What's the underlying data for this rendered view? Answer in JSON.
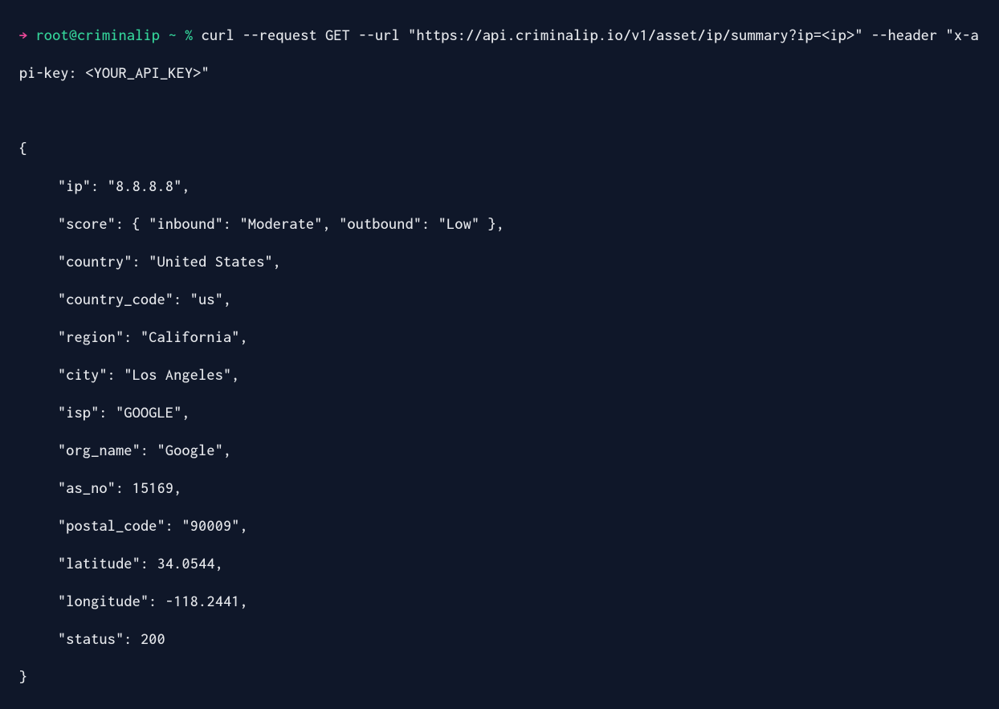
{
  "prompt": {
    "arrow": "→",
    "user_host": "root@criminalip",
    "tilde": "~",
    "percent": "%"
  },
  "command": "curl --request GET --url \"https://api.criminalip.io/v1/asset/ip/summary?ip=<ip>\" --header \"x-api-key: <YOUR_API_KEY>\"",
  "response": {
    "open": "{",
    "lines": [
      "\"ip\": \"8.8.8.8\",",
      "\"score\": { \"inbound\": \"Moderate\", \"outbound\": \"Low\" },",
      "\"country\": \"United States\",",
      "\"country_code\": \"us\",",
      "\"region\": \"California\",",
      "\"city\": \"Los Angeles\",",
      "\"isp\": \"GOOGLE\",",
      "\"org_name\": \"Google\",",
      "\"as_no\": 15169,",
      "\"postal_code\": \"90009\",",
      "\"latitude\": 34.0544,",
      "\"longitude\": -118.2441,",
      "\"status\": 200"
    ],
    "close": "}"
  }
}
